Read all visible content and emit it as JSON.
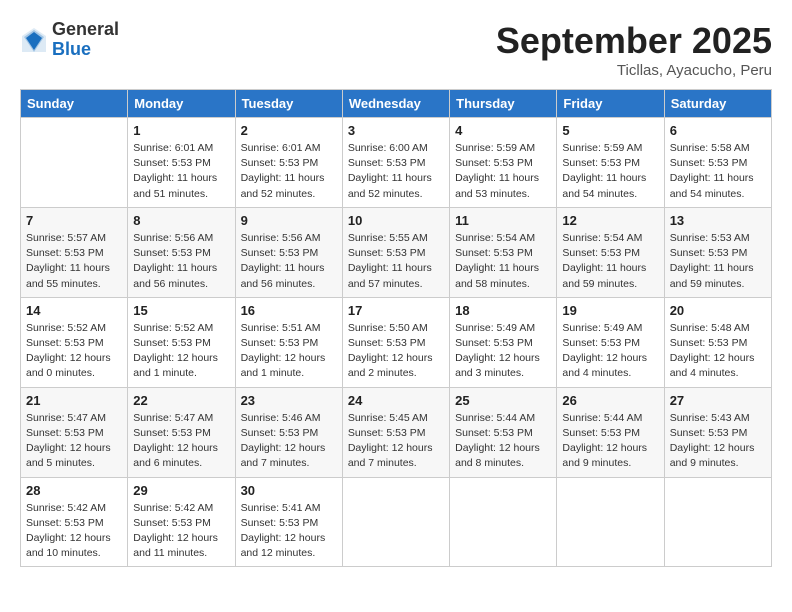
{
  "header": {
    "logo_general": "General",
    "logo_blue": "Blue",
    "title": "September 2025",
    "subtitle": "Ticllas, Ayacucho, Peru"
  },
  "calendar": {
    "days_of_week": [
      "Sunday",
      "Monday",
      "Tuesday",
      "Wednesday",
      "Thursday",
      "Friday",
      "Saturday"
    ],
    "weeks": [
      [
        {
          "num": "",
          "detail": ""
        },
        {
          "num": "1",
          "detail": "Sunrise: 6:01 AM\nSunset: 5:53 PM\nDaylight: 11 hours\nand 51 minutes."
        },
        {
          "num": "2",
          "detail": "Sunrise: 6:01 AM\nSunset: 5:53 PM\nDaylight: 11 hours\nand 52 minutes."
        },
        {
          "num": "3",
          "detail": "Sunrise: 6:00 AM\nSunset: 5:53 PM\nDaylight: 11 hours\nand 52 minutes."
        },
        {
          "num": "4",
          "detail": "Sunrise: 5:59 AM\nSunset: 5:53 PM\nDaylight: 11 hours\nand 53 minutes."
        },
        {
          "num": "5",
          "detail": "Sunrise: 5:59 AM\nSunset: 5:53 PM\nDaylight: 11 hours\nand 54 minutes."
        },
        {
          "num": "6",
          "detail": "Sunrise: 5:58 AM\nSunset: 5:53 PM\nDaylight: 11 hours\nand 54 minutes."
        }
      ],
      [
        {
          "num": "7",
          "detail": "Sunrise: 5:57 AM\nSunset: 5:53 PM\nDaylight: 11 hours\nand 55 minutes."
        },
        {
          "num": "8",
          "detail": "Sunrise: 5:56 AM\nSunset: 5:53 PM\nDaylight: 11 hours\nand 56 minutes."
        },
        {
          "num": "9",
          "detail": "Sunrise: 5:56 AM\nSunset: 5:53 PM\nDaylight: 11 hours\nand 56 minutes."
        },
        {
          "num": "10",
          "detail": "Sunrise: 5:55 AM\nSunset: 5:53 PM\nDaylight: 11 hours\nand 57 minutes."
        },
        {
          "num": "11",
          "detail": "Sunrise: 5:54 AM\nSunset: 5:53 PM\nDaylight: 11 hours\nand 58 minutes."
        },
        {
          "num": "12",
          "detail": "Sunrise: 5:54 AM\nSunset: 5:53 PM\nDaylight: 11 hours\nand 59 minutes."
        },
        {
          "num": "13",
          "detail": "Sunrise: 5:53 AM\nSunset: 5:53 PM\nDaylight: 11 hours\nand 59 minutes."
        }
      ],
      [
        {
          "num": "14",
          "detail": "Sunrise: 5:52 AM\nSunset: 5:53 PM\nDaylight: 12 hours\nand 0 minutes."
        },
        {
          "num": "15",
          "detail": "Sunrise: 5:52 AM\nSunset: 5:53 PM\nDaylight: 12 hours\nand 1 minute."
        },
        {
          "num": "16",
          "detail": "Sunrise: 5:51 AM\nSunset: 5:53 PM\nDaylight: 12 hours\nand 1 minute."
        },
        {
          "num": "17",
          "detail": "Sunrise: 5:50 AM\nSunset: 5:53 PM\nDaylight: 12 hours\nand 2 minutes."
        },
        {
          "num": "18",
          "detail": "Sunrise: 5:49 AM\nSunset: 5:53 PM\nDaylight: 12 hours\nand 3 minutes."
        },
        {
          "num": "19",
          "detail": "Sunrise: 5:49 AM\nSunset: 5:53 PM\nDaylight: 12 hours\nand 4 minutes."
        },
        {
          "num": "20",
          "detail": "Sunrise: 5:48 AM\nSunset: 5:53 PM\nDaylight: 12 hours\nand 4 minutes."
        }
      ],
      [
        {
          "num": "21",
          "detail": "Sunrise: 5:47 AM\nSunset: 5:53 PM\nDaylight: 12 hours\nand 5 minutes."
        },
        {
          "num": "22",
          "detail": "Sunrise: 5:47 AM\nSunset: 5:53 PM\nDaylight: 12 hours\nand 6 minutes."
        },
        {
          "num": "23",
          "detail": "Sunrise: 5:46 AM\nSunset: 5:53 PM\nDaylight: 12 hours\nand 7 minutes."
        },
        {
          "num": "24",
          "detail": "Sunrise: 5:45 AM\nSunset: 5:53 PM\nDaylight: 12 hours\nand 7 minutes."
        },
        {
          "num": "25",
          "detail": "Sunrise: 5:44 AM\nSunset: 5:53 PM\nDaylight: 12 hours\nand 8 minutes."
        },
        {
          "num": "26",
          "detail": "Sunrise: 5:44 AM\nSunset: 5:53 PM\nDaylight: 12 hours\nand 9 minutes."
        },
        {
          "num": "27",
          "detail": "Sunrise: 5:43 AM\nSunset: 5:53 PM\nDaylight: 12 hours\nand 9 minutes."
        }
      ],
      [
        {
          "num": "28",
          "detail": "Sunrise: 5:42 AM\nSunset: 5:53 PM\nDaylight: 12 hours\nand 10 minutes."
        },
        {
          "num": "29",
          "detail": "Sunrise: 5:42 AM\nSunset: 5:53 PM\nDaylight: 12 hours\nand 11 minutes."
        },
        {
          "num": "30",
          "detail": "Sunrise: 5:41 AM\nSunset: 5:53 PM\nDaylight: 12 hours\nand 12 minutes."
        },
        {
          "num": "",
          "detail": ""
        },
        {
          "num": "",
          "detail": ""
        },
        {
          "num": "",
          "detail": ""
        },
        {
          "num": "",
          "detail": ""
        }
      ]
    ]
  }
}
